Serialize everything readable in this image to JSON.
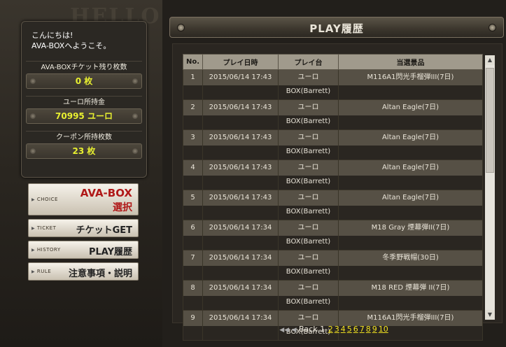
{
  "sidebar": {
    "bg_text": "HELLO",
    "greeting_line1": "こんにちは!",
    "greeting_line2": "AVA-BOXへようこそ。",
    "stats": [
      {
        "label": "AVA-BOXチケット残り枚数",
        "value": "0 枚"
      },
      {
        "label": "ユーロ所持金",
        "value": "70995 ユーロ"
      },
      {
        "label": "クーポン所持枚数",
        "value": "23 枚"
      }
    ],
    "menu": [
      {
        "small": "CHOICE",
        "big": "AVA-BOX",
        "big2": "選択"
      },
      {
        "small": "TICKET",
        "big": "チケットGET"
      },
      {
        "small": "HISTORY",
        "big": "PLAY履歴"
      },
      {
        "small": "RULE",
        "big": "注意事項・説明"
      }
    ]
  },
  "main": {
    "title": "PLAY履歴",
    "columns": [
      "No.",
      "プレイ日時",
      "プレイ台",
      "当選景品"
    ],
    "rows": [
      {
        "no": "1",
        "date": "2015/06/14 17:43",
        "machine1": "ユーロ",
        "machine2": "BOX(Barrett)",
        "prize": "M116A1閃光手榴弾III(7日)"
      },
      {
        "no": "2",
        "date": "2015/06/14 17:43",
        "machine1": "ユーロ",
        "machine2": "BOX(Barrett)",
        "prize": "Altan Eagle(7日)"
      },
      {
        "no": "3",
        "date": "2015/06/14 17:43",
        "machine1": "ユーロ",
        "machine2": "BOX(Barrett)",
        "prize": "Altan Eagle(7日)"
      },
      {
        "no": "4",
        "date": "2015/06/14 17:43",
        "machine1": "ユーロ",
        "machine2": "BOX(Barrett)",
        "prize": "Altan Eagle(7日)"
      },
      {
        "no": "5",
        "date": "2015/06/14 17:43",
        "machine1": "ユーロ",
        "machine2": "BOX(Barrett)",
        "prize": "Altan Eagle(7日)"
      },
      {
        "no": "6",
        "date": "2015/06/14 17:34",
        "machine1": "ユーロ",
        "machine2": "BOX(Barrett)",
        "prize": "M18 Gray 煙幕弾II(7日)"
      },
      {
        "no": "7",
        "date": "2015/06/14 17:34",
        "machine1": "ユーロ",
        "machine2": "BOX(Barrett)",
        "prize": "冬季野戦帽(30日)"
      },
      {
        "no": "8",
        "date": "2015/06/14 17:34",
        "machine1": "ユーロ",
        "machine2": "BOX(Barrett)",
        "prize": "M18 RED 煙幕弾 II(7日)"
      },
      {
        "no": "9",
        "date": "2015/06/14 17:34",
        "machine1": "ユーロ",
        "machine2": "BOX(Barrett)",
        "prize": "M116A1閃光手榴弾III(7日)"
      }
    ],
    "pager": {
      "back": "Back",
      "current": "1",
      "pages": [
        "2",
        "3",
        "4",
        "5",
        "6",
        "7",
        "8",
        "9",
        "10"
      ]
    }
  }
}
